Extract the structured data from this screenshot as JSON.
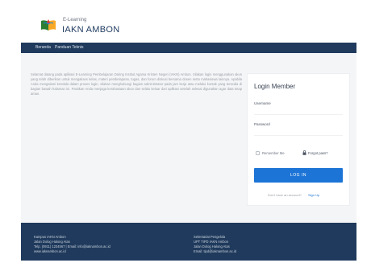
{
  "header": {
    "logo_small": "E-Learning",
    "logo_big": "IAKN AMBON",
    "logo_icon": "book-icon"
  },
  "nav": {
    "items": [
      {
        "label": "Beranda"
      },
      {
        "label": "Panduan Teknis"
      }
    ]
  },
  "intro": {
    "text": "Selamat datang pada aplikasi E-Learning Pembelajaran Daring Institut Agama Kristen Negeri (IAKN) Ambon. Silakan login menggunakan akun yang telah diberikan untuk mengakses kelas, materi pembelajaran, tugas, dan forum diskusi bersama dosen serta mahasiswa lainnya. Apabila Anda mengalami kendala dalam proses login, silakan menghubungi bagian administrator pada jam kerja atau melalui kontak yang tersedia di bagian bawah halaman ini. Pastikan Anda menjaga kerahasiaan akun dan selalu keluar dari aplikasi setelah selesai digunakan agar data tetap aman."
  },
  "login": {
    "title": "Login Member",
    "username_label": "Username",
    "username_value": "",
    "password_label": "Password",
    "password_value": "",
    "remember_label": "Remember Me",
    "remember_checked": false,
    "forgot_label": "Forgot pass?",
    "button_label": "LOG IN",
    "signup_prompt": "Don't have an account?",
    "signup_link": "Sign Up",
    "accent_color": "#1c74d6"
  },
  "footer": {
    "left": [
      "Kampus IAKN Ambon",
      "Jalan Dolog Halong Atas",
      "Telp. (0911) 1234567 | Email: info@iaknambon.ac.id",
      "www.iaknambon.ac.id"
    ],
    "right": [
      "Sekretariat Pengelola",
      "UPT TIPD IAKN Ambon",
      "Jalan Dolog Halong Atas",
      "Email: tipd@iaknambon.ac.id"
    ],
    "background_color": "#1f3a5c"
  }
}
